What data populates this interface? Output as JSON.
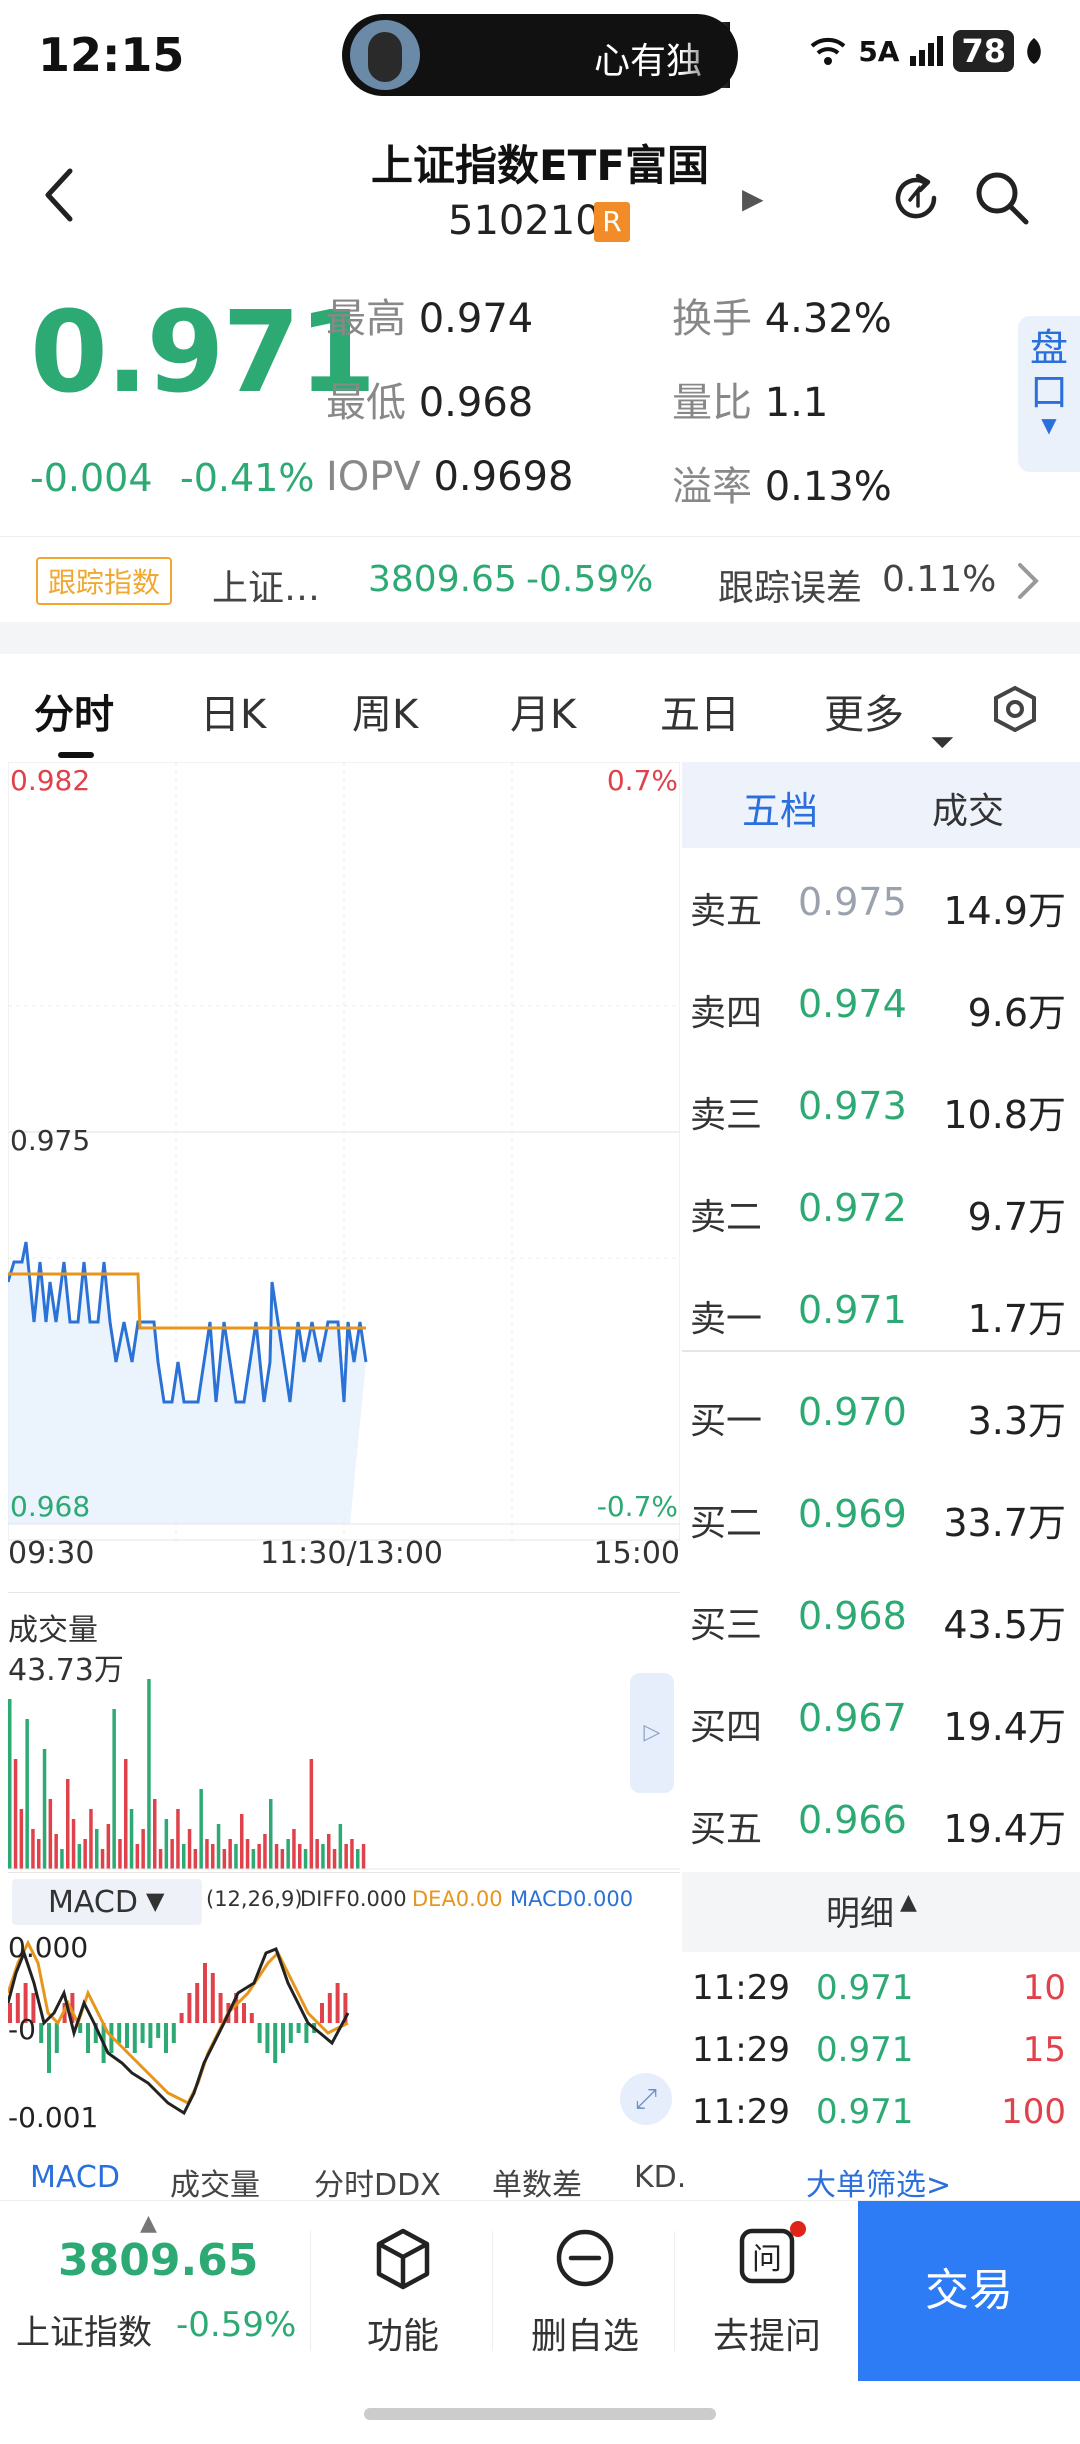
{
  "status": {
    "time": "12:15",
    "pill_text": "心有独",
    "network": "5A",
    "battery": "78"
  },
  "header": {
    "title": "上证指数ETF富国",
    "code": "510210",
    "code_badge": "R"
  },
  "quote": {
    "price": "0.971",
    "change": "-0.004",
    "change_pct": "-0.41%",
    "high_label": "最高",
    "high": "0.974",
    "low_label": "最低",
    "low": "0.968",
    "iopv_label": "IOPV",
    "iopv": "0.9698",
    "turnover_label": "换手",
    "turnover": "4.32%",
    "vol_ratio_label": "量比",
    "vol_ratio": "1.1",
    "premium_label": "溢率",
    "premium": "0.13%",
    "pankou": "盘口"
  },
  "tracking": {
    "badge": "跟踪指数",
    "index_name": "上证…",
    "index_value": "3809.65",
    "index_change": "-0.59%",
    "error_label": "跟踪误差",
    "error_value": "0.11%"
  },
  "tabs": [
    "分时",
    "日K",
    "周K",
    "月K",
    "五日",
    "更多"
  ],
  "intraday": {
    "y_top": "0.982",
    "y_mid": "0.975",
    "y_bottom": "0.968",
    "pct_top": "0.7%",
    "pct_bottom": "-0.7%",
    "x_start": "09:30",
    "x_mid": "11:30/13:00",
    "x_end": "15:00",
    "volume_title": "成交量",
    "volume_max": "43.73万",
    "macd_selector": "MACD",
    "macd_params": "(12,26,9)",
    "diff": "DIFF0.000",
    "dea": "DEA0.00",
    "macd": "MACD0.000",
    "macd_top": "0.000",
    "macd_mid": "-0",
    "macd_bottom": "-0.001"
  },
  "orderbook": {
    "tab_five": "五档",
    "tab_trades": "成交",
    "asks": [
      {
        "label": "卖五",
        "price": "0.975",
        "volume": "14.9万"
      },
      {
        "label": "卖四",
        "price": "0.974",
        "volume": "9.6万"
      },
      {
        "label": "卖三",
        "price": "0.973",
        "volume": "10.8万"
      },
      {
        "label": "卖二",
        "price": "0.972",
        "volume": "9.7万"
      },
      {
        "label": "卖一",
        "price": "0.971",
        "volume": "1.7万"
      }
    ],
    "bids": [
      {
        "label": "买一",
        "price": "0.970",
        "volume": "3.3万"
      },
      {
        "label": "买二",
        "price": "0.969",
        "volume": "33.7万"
      },
      {
        "label": "买三",
        "price": "0.968",
        "volume": "43.5万"
      },
      {
        "label": "买四",
        "price": "0.967",
        "volume": "19.4万"
      },
      {
        "label": "买五",
        "price": "0.966",
        "volume": "19.4万"
      }
    ],
    "detail_title": "明细",
    "details": [
      {
        "time": "11:29",
        "price": "0.971",
        "volume": "10"
      },
      {
        "time": "11:29",
        "price": "0.971",
        "volume": "15"
      },
      {
        "time": "11:29",
        "price": "0.971",
        "volume": "100"
      }
    ],
    "big_order_filter": "大单筛选>"
  },
  "indicator_tabs": [
    "MACD",
    "成交量",
    "分时DDX",
    "单数差",
    "KD."
  ],
  "bottom": {
    "index_value": "3809.65",
    "index_name": "上证指数",
    "index_change": "-0.59%",
    "func": "功能",
    "remove_watch": "删自选",
    "ask": "去提问",
    "trade": "交易"
  },
  "colors": {
    "up": "#e0424b",
    "down": "#2daa74",
    "accent": "#2d7cf6",
    "line_price": "#2b72d6",
    "line_avg": "#e8951c"
  }
}
